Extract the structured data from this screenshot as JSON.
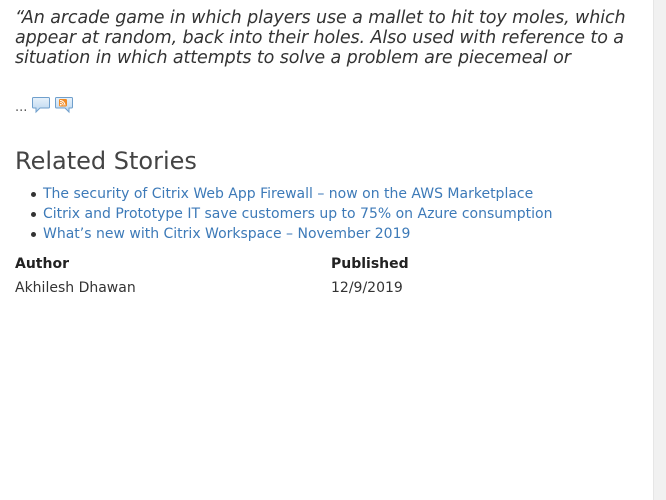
{
  "quote": {
    "text": "“An arcade game in which players use a mallet to hit toy moles, which appear at random, back into their holes. Also used with reference to a situation in which attempts to solve a problem are piecemeal or",
    "ellipsis": "...",
    "icons": [
      "comment-bubble-icon",
      "rss-feed-icon"
    ]
  },
  "related": {
    "title": "Related Stories",
    "stories": [
      {
        "label": "The security of Citrix Web App Firewall – now on the AWS Marketplace"
      },
      {
        "label": "Citrix and Prototype IT save customers up to 75% on Azure consumption"
      },
      {
        "label": "What’s new with Citrix Workspace – November 2019"
      }
    ]
  },
  "meta": {
    "author_label": "Author",
    "author_value": "Akhilesh Dhawan",
    "published_label": "Published",
    "published_value": "12/9/2019"
  },
  "colors": {
    "link": "#3d7ab8",
    "text": "#333333",
    "icon_blue": "#8fb8dc",
    "icon_orange": "#f08a24"
  }
}
